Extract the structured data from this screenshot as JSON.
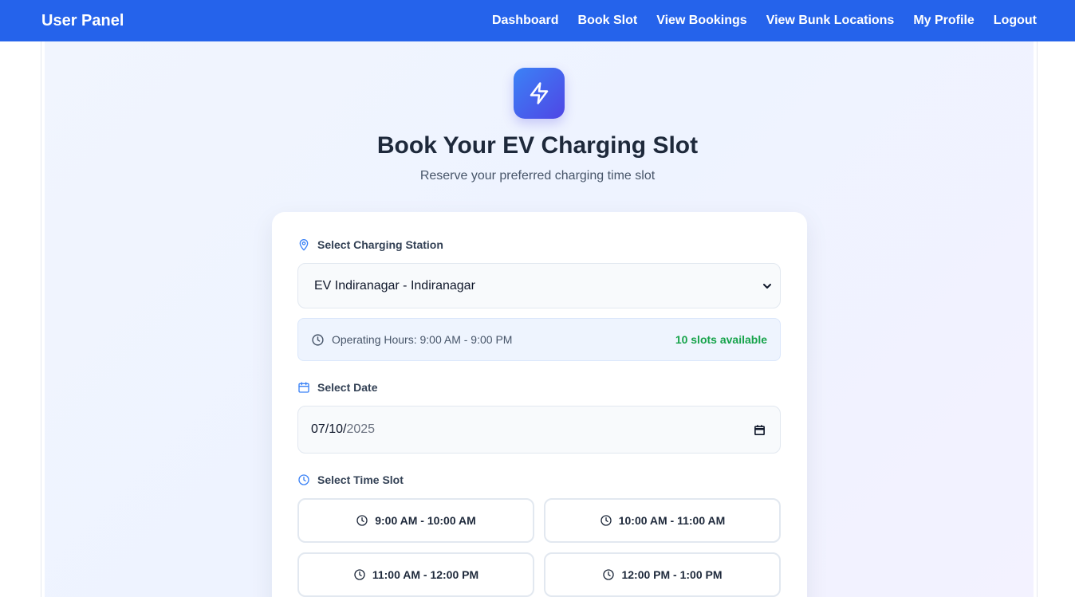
{
  "nav": {
    "brand": "User Panel",
    "links": [
      "Dashboard",
      "Book Slot",
      "View Bookings",
      "View Bunk Locations",
      "My Profile",
      "Logout"
    ]
  },
  "hero": {
    "icon": "lightning-bolt-icon",
    "title": "Book Your EV Charging Slot",
    "subtitle": "Reserve your preferred charging time slot"
  },
  "form": {
    "station_label": "Select Charging Station",
    "station_value": "EV Indiranagar - Indiranagar",
    "operating_hours": "Operating Hours: 9:00 AM - 9:00 PM",
    "slots_available": "10 slots available",
    "date_label": "Select Date",
    "date_value": {
      "month_day": "07/10/",
      "year": "2025"
    },
    "time_label": "Select Time Slot",
    "slots": [
      "9:00 AM - 10:00 AM",
      "10:00 AM - 11:00 AM",
      "11:00 AM - 12:00 PM",
      "12:00 PM - 1:00 PM"
    ]
  },
  "colors": {
    "nav_bg": "#2563eb",
    "accent": "#3b82f6",
    "success": "#16a34a"
  }
}
